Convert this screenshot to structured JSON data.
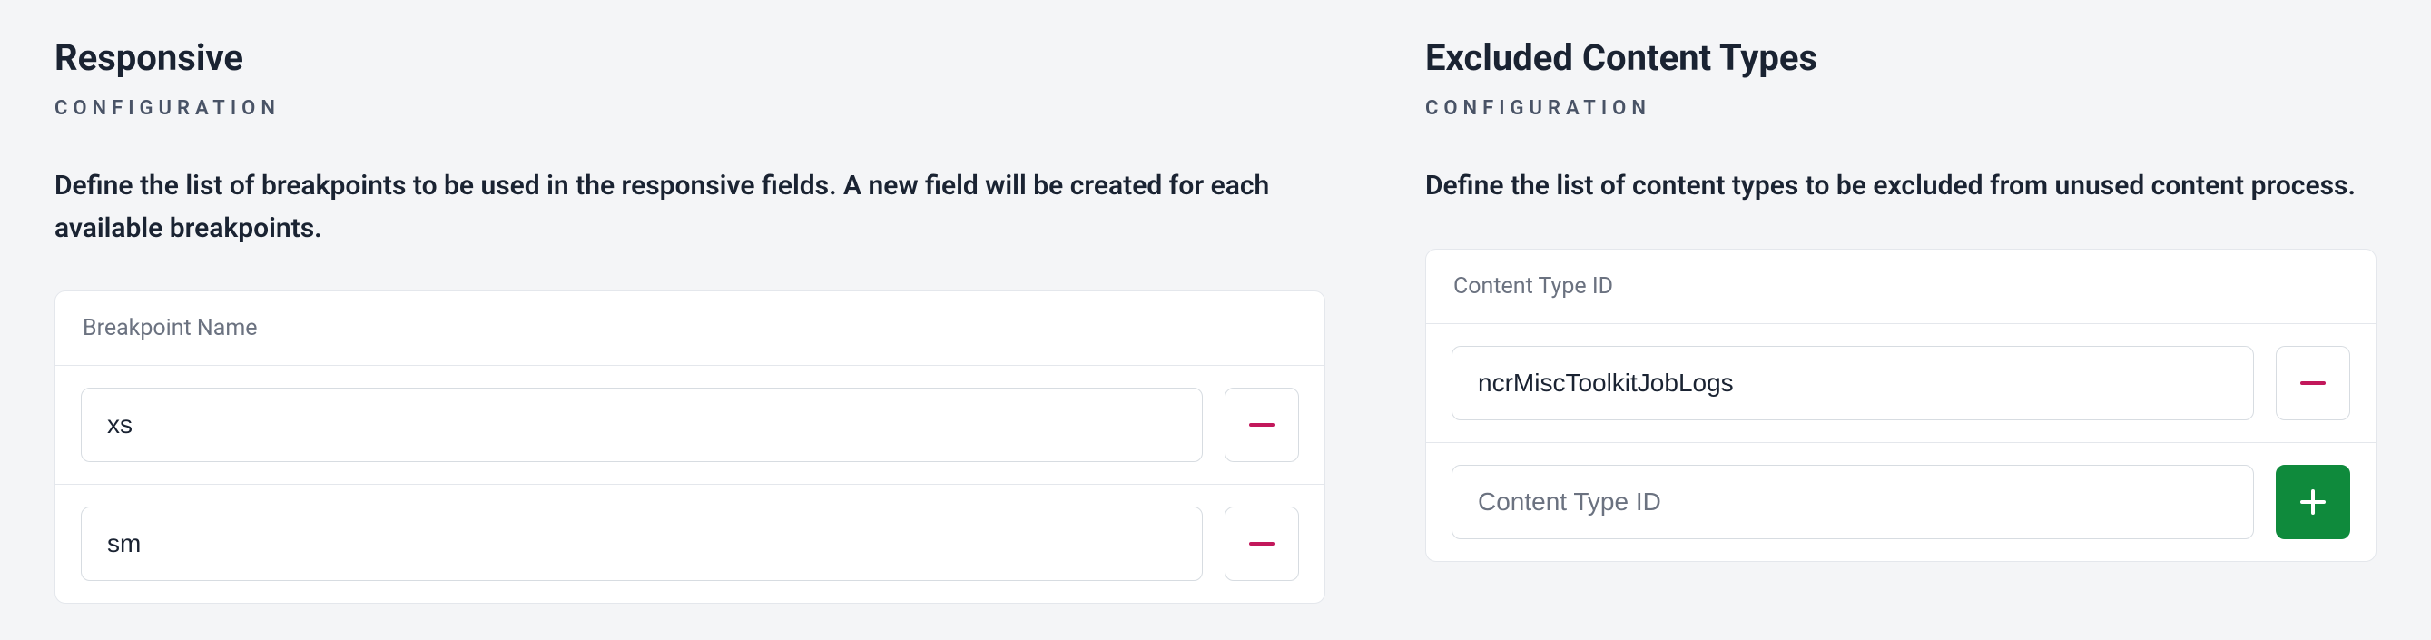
{
  "left": {
    "title": "Responsive",
    "subtitle": "CONFIGURATION",
    "description": "Define the list of breakpoints to be used in the responsive fields. A new field will be created for each available breakpoints.",
    "header": "Breakpoint Name",
    "rows": [
      {
        "value": "xs"
      },
      {
        "value": "sm"
      }
    ]
  },
  "right": {
    "title": "Excluded Content Types",
    "subtitle": "CONFIGURATION",
    "description": "Define the list of content types to be excluded from unused content process.",
    "header": "Content Type ID",
    "rows": [
      {
        "value": "ncrMiscToolkitJobLogs"
      }
    ],
    "new_placeholder": "Content Type ID"
  }
}
